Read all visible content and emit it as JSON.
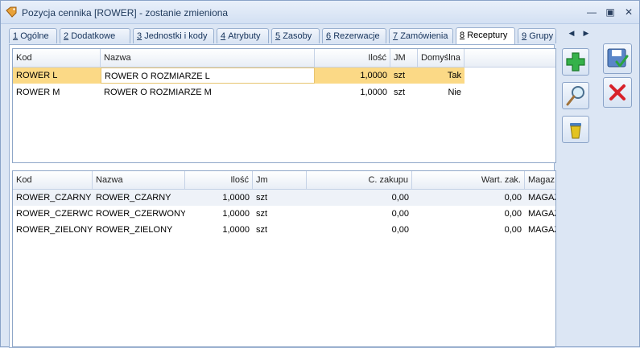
{
  "window": {
    "title": "Pozycja cennika [ROWER] - zostanie zmieniona"
  },
  "tabs": [
    {
      "num": "1",
      "label": "Ogólne"
    },
    {
      "num": "2",
      "label": "Dodatkowe"
    },
    {
      "num": "3",
      "label": "Jednostki i kody"
    },
    {
      "num": "4",
      "label": "Atrybuty"
    },
    {
      "num": "5",
      "label": "Zasoby"
    },
    {
      "num": "6",
      "label": "Rezerwacje"
    },
    {
      "num": "7",
      "label": "Zamówienia"
    },
    {
      "num": "8",
      "label": "Receptury"
    },
    {
      "num": "9",
      "label": "Grupy"
    }
  ],
  "active_tab": "8",
  "recipes": {
    "columns": [
      "Kod",
      "Nazwa",
      "Ilość",
      "JM",
      "Domyślna"
    ],
    "rows": [
      [
        "ROWER L",
        "ROWER O ROZMIARZE L",
        "1,0000",
        "szt",
        "Tak"
      ],
      [
        "ROWER M",
        "ROWER O ROZMIARZE M",
        "1,0000",
        "szt",
        "Nie"
      ]
    ]
  },
  "components": {
    "columns": [
      "Kod",
      "Nazwa",
      "Ilość",
      "Jm",
      "C. zakupu",
      "Wart. zak.",
      "Magaz"
    ],
    "rows": [
      [
        "ROWER_CZARNY",
        "ROWER_CZARNY",
        "1,0000",
        "szt",
        "0,00",
        "0,00",
        "MAGAZ"
      ],
      [
        "ROWER_CZERWO...",
        "ROWER_CZERWONY",
        "1,0000",
        "szt",
        "0,00",
        "0,00",
        "MAGAZ"
      ],
      [
        "ROWER_ZIELONY",
        "ROWER_ZIELONY",
        "1,0000",
        "szt",
        "0,00",
        "0,00",
        "MAGAZ"
      ]
    ]
  },
  "icons": {
    "add": "plus-icon",
    "preview": "magnifier-icon",
    "delete": "trash-icon",
    "save": "save-icon",
    "cancel": "close-icon"
  },
  "colors": {
    "selection": "#fbd986",
    "accent": "#1e395b"
  }
}
